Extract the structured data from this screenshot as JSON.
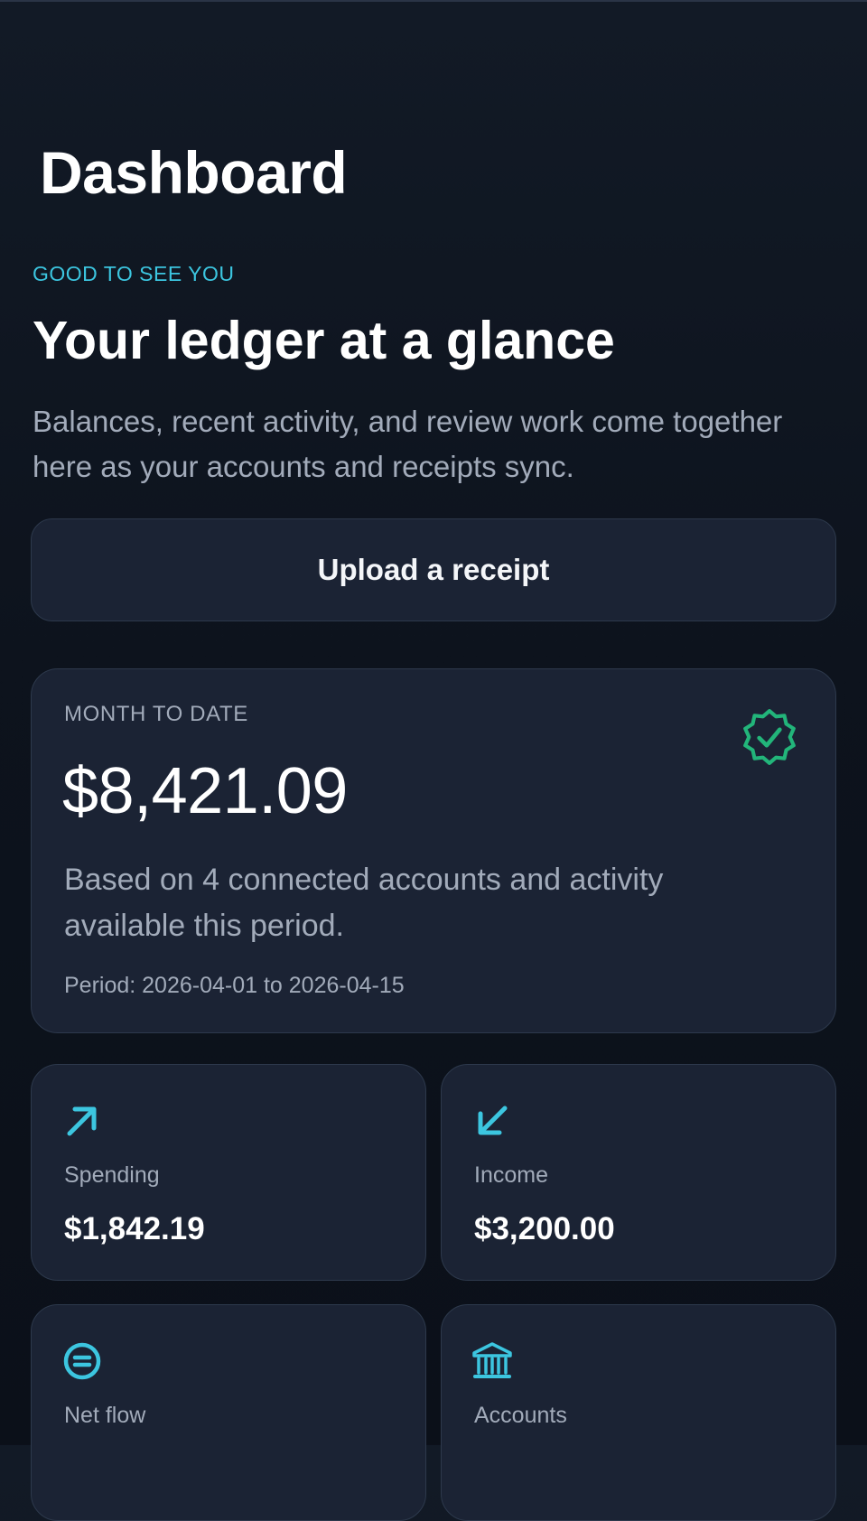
{
  "header": {
    "title": "Dashboard"
  },
  "hero": {
    "eyebrow": "GOOD TO SEE YOU",
    "title": "Your ledger at a glance",
    "subtitle": "Balances, recent activity, and review work come together here as your accounts and receipts sync."
  },
  "actions": {
    "upload_label": "Upload a receipt"
  },
  "month_to_date": {
    "label": "MONTH TO DATE",
    "amount": "$8,421.09",
    "description": "Based on 4 connected accounts and activity available this period.",
    "period": "Period: 2026-04-01 to 2026-04-15",
    "icon": "verified-badge-icon",
    "icon_color": "#22b57a"
  },
  "stats": [
    {
      "label": "Spending",
      "value": "$1,842.19",
      "icon": "arrow-up-right-icon"
    },
    {
      "label": "Income",
      "value": "$3,200.00",
      "icon": "arrow-down-left-icon"
    },
    {
      "label": "Net flow",
      "value": "",
      "icon": "equals-circle-icon"
    },
    {
      "label": "Accounts",
      "value": "",
      "icon": "bank-icon"
    }
  ],
  "colors": {
    "background": "#0d131d",
    "card": "#1b2334",
    "card_border": "#2d394c",
    "accent": "#3cc6e0",
    "success": "#22b57a",
    "muted_text": "#a2abba"
  }
}
